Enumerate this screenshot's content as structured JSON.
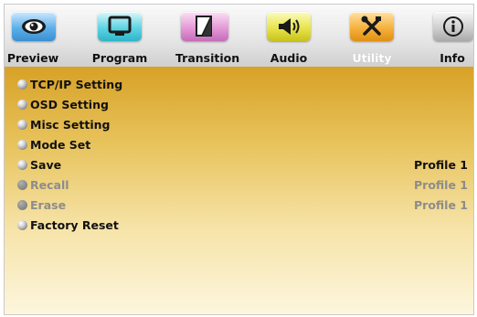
{
  "tabs": [
    {
      "label": "Preview",
      "icon": "eye-icon",
      "color": "#5db0e8"
    },
    {
      "label": "Program",
      "icon": "monitor-icon",
      "color": "#5fd4e2"
    },
    {
      "label": "Transition",
      "icon": "transition-icon",
      "color": "#e59ad6"
    },
    {
      "label": "Audio",
      "icon": "speaker-icon",
      "color": "#e9e44c"
    },
    {
      "label": "Utility",
      "icon": "tools-icon",
      "color": "#f6b23e",
      "selected": true
    },
    {
      "label": "Info",
      "icon": "info-icon",
      "color": "#cfcfcf"
    }
  ],
  "menu": [
    {
      "label": "TCP/IP Setting",
      "enabled": true
    },
    {
      "label": "OSD Setting",
      "enabled": true
    },
    {
      "label": "Misc Setting",
      "enabled": true
    },
    {
      "label": "Mode Set",
      "enabled": true
    },
    {
      "label": "Save",
      "value": "Profile 1",
      "enabled": true
    },
    {
      "label": "Recall",
      "value": "Profile 1",
      "enabled": false
    },
    {
      "label": "Erase",
      "value": "Profile 1",
      "enabled": false
    },
    {
      "label": "Factory Reset",
      "enabled": true
    }
  ],
  "colors": {
    "content_top": "#d8a126",
    "content_bottom": "#fdf6de",
    "disabled_text": "#8c8c8c"
  }
}
